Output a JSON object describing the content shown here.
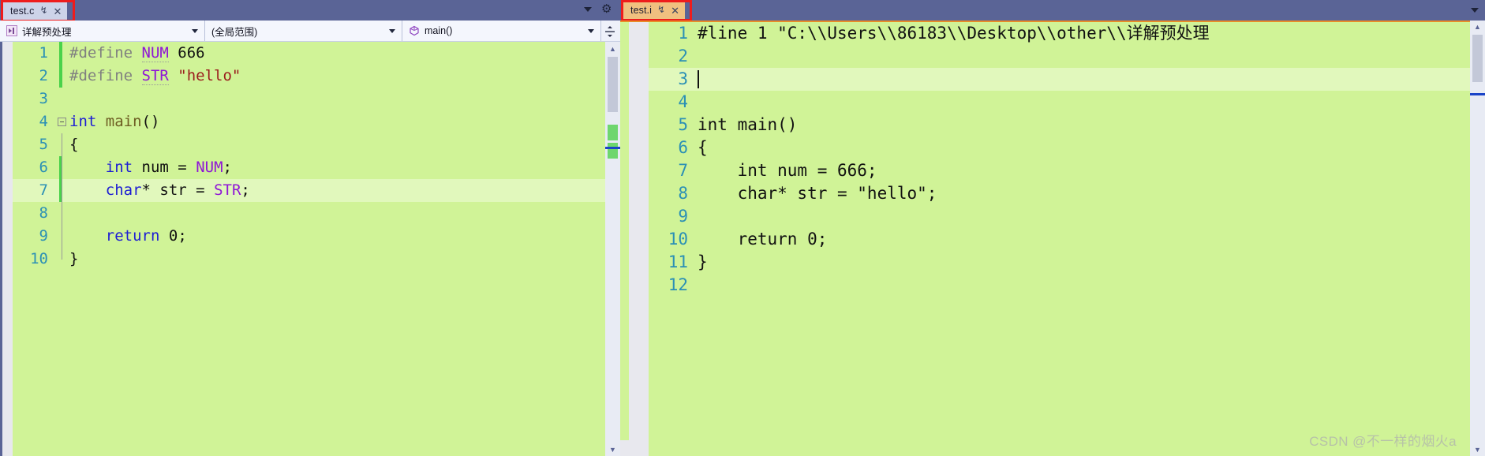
{
  "window": {
    "background_color": "#5a6496",
    "editor_background": "#d0f397",
    "current_line_background": "#e1f8bc",
    "accent_red": "#ee1c1c",
    "accent_orange": "#f0c080"
  },
  "left_pane": {
    "tab": {
      "title": "test.c",
      "pin_icon": "↯",
      "close_icon": "✕"
    },
    "navbar": {
      "project_scope": {
        "icon": "preprocess-icon",
        "label": "详解预处理"
      },
      "member_scope": {
        "label": "(全局范围)"
      },
      "function_scope": {
        "icon": "method-icon",
        "label": "main()"
      },
      "split_icon": "↕"
    },
    "code_lines": [
      {
        "num": "1",
        "changed": true,
        "current": false,
        "fold": "none",
        "segments": [
          {
            "t": "#define ",
            "c": "tk-pre"
          },
          {
            "t": "NUM",
            "c": "tk-macro tk-sqg"
          },
          {
            "t": " ",
            "c": "tk-plain"
          },
          {
            "t": "666",
            "c": "tk-num"
          }
        ]
      },
      {
        "num": "2",
        "changed": true,
        "current": false,
        "fold": "none",
        "segments": [
          {
            "t": "#define ",
            "c": "tk-pre"
          },
          {
            "t": "STR",
            "c": "tk-macro tk-sqg"
          },
          {
            "t": " ",
            "c": "tk-plain"
          },
          {
            "t": "\"hello\"",
            "c": "tk-str"
          }
        ]
      },
      {
        "num": "3",
        "changed": false,
        "current": false,
        "fold": "none",
        "segments": []
      },
      {
        "num": "4",
        "changed": false,
        "current": false,
        "fold": "box",
        "segments": [
          {
            "t": "int",
            "c": "tk-kw"
          },
          {
            "t": " ",
            "c": "tk-plain"
          },
          {
            "t": "main",
            "c": "tk-fn"
          },
          {
            "t": "()",
            "c": "tk-plain"
          }
        ]
      },
      {
        "num": "5",
        "changed": false,
        "current": false,
        "fold": "line",
        "segments": [
          {
            "t": "{",
            "c": "tk-plain"
          }
        ]
      },
      {
        "num": "6",
        "changed": true,
        "current": false,
        "fold": "line",
        "segments": [
          {
            "t": "    ",
            "c": "tk-plain"
          },
          {
            "t": "int",
            "c": "tk-kw"
          },
          {
            "t": " num ",
            "c": "tk-plain"
          },
          {
            "t": "= ",
            "c": "tk-plain"
          },
          {
            "t": "NUM",
            "c": "tk-macro"
          },
          {
            "t": ";",
            "c": "tk-plain"
          }
        ]
      },
      {
        "num": "7",
        "changed": true,
        "current": true,
        "fold": "line",
        "segments": [
          {
            "t": "    ",
            "c": "tk-plain"
          },
          {
            "t": "char",
            "c": "tk-kw"
          },
          {
            "t": "* str ",
            "c": "tk-plain"
          },
          {
            "t": "= ",
            "c": "tk-plain"
          },
          {
            "t": "STR",
            "c": "tk-macro"
          },
          {
            "t": ";",
            "c": "tk-plain"
          }
        ]
      },
      {
        "num": "8",
        "changed": false,
        "current": false,
        "fold": "line",
        "segments": []
      },
      {
        "num": "9",
        "changed": false,
        "current": false,
        "fold": "line",
        "segments": [
          {
            "t": "    ",
            "c": "tk-plain"
          },
          {
            "t": "return",
            "c": "tk-kw"
          },
          {
            "t": " ",
            "c": "tk-plain"
          },
          {
            "t": "0",
            "c": "tk-num"
          },
          {
            "t": ";",
            "c": "tk-plain"
          }
        ]
      },
      {
        "num": "10",
        "changed": false,
        "current": false,
        "fold": "end",
        "segments": [
          {
            "t": "}",
            "c": "tk-plain"
          }
        ]
      }
    ],
    "scrollbar": {
      "up_arrow": "▲",
      "down_arrow": "▼"
    }
  },
  "right_pane": {
    "tab": {
      "title": "test.i",
      "pin_icon": "↯",
      "close_icon": "✕"
    },
    "header": {
      "dropdown_icon": "▼",
      "gear_icon": "⚙"
    },
    "code_lines": [
      {
        "num": "1",
        "current": false,
        "text": "#line 1 \"C:\\\\Users\\\\86183\\\\Desktop\\\\other\\\\详解预处理"
      },
      {
        "num": "2",
        "current": false,
        "text": ""
      },
      {
        "num": "3",
        "current": true,
        "text": "",
        "caret": true
      },
      {
        "num": "4",
        "current": false,
        "text": ""
      },
      {
        "num": "5",
        "current": false,
        "text": "int main()"
      },
      {
        "num": "6",
        "current": false,
        "text": "{"
      },
      {
        "num": "7",
        "current": false,
        "text": "    int num = 666;"
      },
      {
        "num": "8",
        "current": false,
        "text": "    char* str = \"hello\";"
      },
      {
        "num": "9",
        "current": false,
        "text": ""
      },
      {
        "num": "10",
        "current": false,
        "text": "    return 0;"
      },
      {
        "num": "11",
        "current": false,
        "text": "}"
      },
      {
        "num": "12",
        "current": false,
        "text": ""
      }
    ],
    "scrollbar": {
      "up_arrow": "▲",
      "down_arrow": "▼"
    }
  },
  "watermark": {
    "text": "CSDN @不一样的烟火a"
  }
}
